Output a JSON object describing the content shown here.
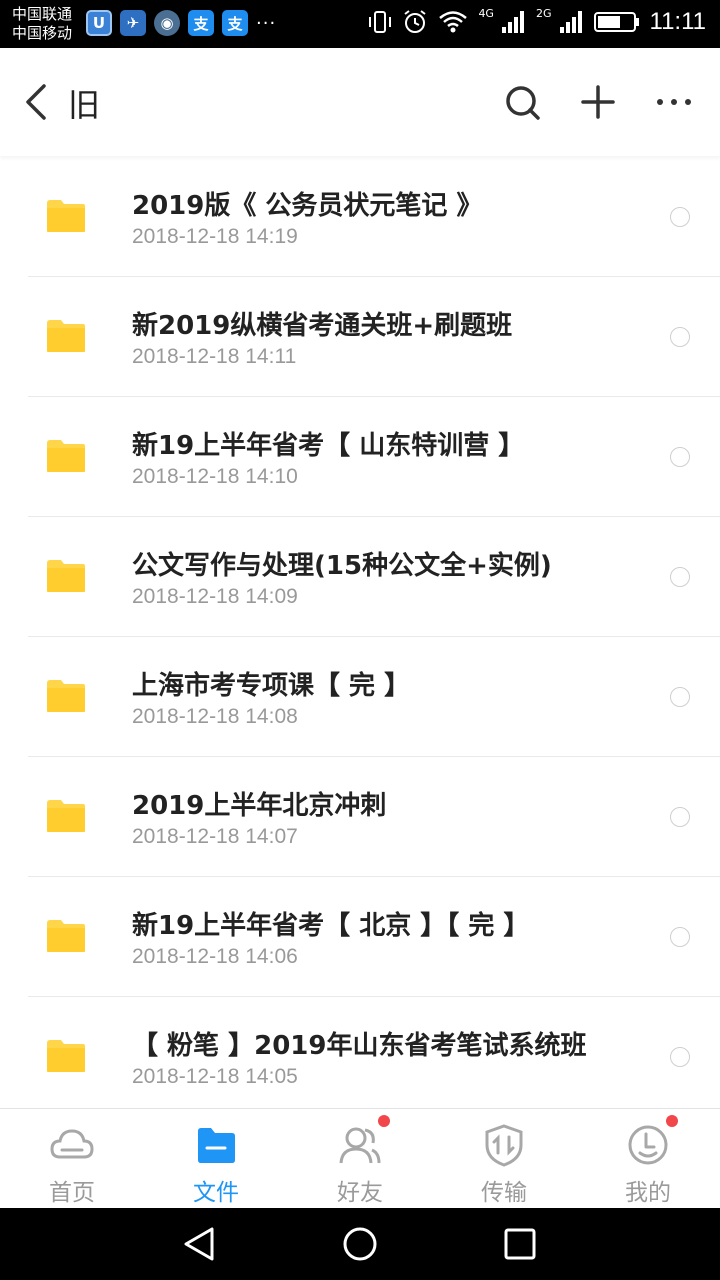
{
  "status_bar": {
    "carrier_1": "中国联通",
    "carrier_2": "中国移动",
    "network_1": "4G",
    "network_2": "2G",
    "time": "11:11",
    "app_icons": [
      "U",
      "✈",
      "◉",
      "支",
      "支"
    ],
    "more": "···"
  },
  "header": {
    "title": "旧",
    "icons": [
      "back-icon",
      "search-icon",
      "plus-icon",
      "more-icon"
    ]
  },
  "files": [
    {
      "name": "2019版《 公务员状元笔记 》",
      "date": "2018-12-18  14:19"
    },
    {
      "name": "新2019纵横省考通关班+刷题班",
      "date": "2018-12-18  14:11"
    },
    {
      "name": "新19上半年省考【 山东特训营 】",
      "date": "2018-12-18  14:10"
    },
    {
      "name": "公文写作与处理(15种公文全+实例)",
      "date": "2018-12-18  14:09"
    },
    {
      "name": "上海市考专项课【 完 】",
      "date": "2018-12-18  14:08"
    },
    {
      "name": "2019上半年北京冲刺",
      "date": "2018-12-18  14:07"
    },
    {
      "name": "新19上半年省考【 北京 】【 完 】",
      "date": "2018-12-18  14:06"
    },
    {
      "name": "【 粉笔 】2019年山东省考笔试系统班",
      "date": "2018-12-18  14:05"
    }
  ],
  "tabs": [
    {
      "label": "首页",
      "active": false,
      "badge": false
    },
    {
      "label": "文件",
      "active": true,
      "badge": false
    },
    {
      "label": "好友",
      "active": false,
      "badge": true
    },
    {
      "label": "传输",
      "active": false,
      "badge": false
    },
    {
      "label": "我的",
      "active": false,
      "badge": true
    }
  ],
  "colors": {
    "accent": "#1f95f5",
    "folder": "#ffd54a",
    "badge": "#f2474a",
    "text_primary": "#222222",
    "text_secondary": "#999999"
  }
}
